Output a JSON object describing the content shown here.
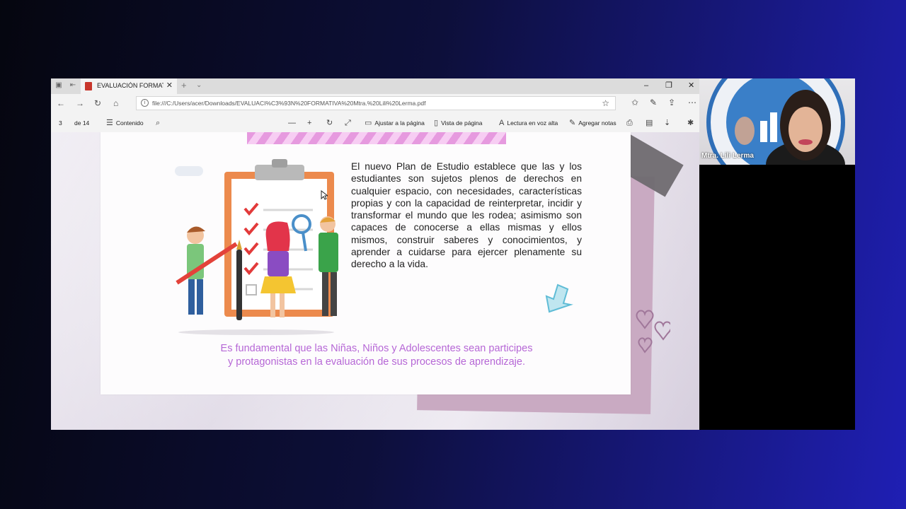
{
  "browser": {
    "tab_title": "EVALUACIÓN FORMATIV",
    "url": "file:///C:/Users/acer/Downloads/EVALUACI%C3%93N%20FORMATIVA%20Mtra.%20Lili%20Lerma.pdf",
    "window_controls": [
      "–",
      "❐",
      "✕"
    ]
  },
  "pdf_toolbar": {
    "page_current": "3",
    "page_total": "de 14",
    "contents_label": "Contenido",
    "fit_page_label": "Ajustar a la página",
    "page_view_label": "Vista de página",
    "read_aloud_label": "Lectura en voz alta",
    "add_notes_label": "Agregar notas"
  },
  "slide": {
    "body": "El nuevo Plan de Estudio establece que las y los estudiantes son sujetos plenos de derechos en cualquier espacio, con necesidades, características propias y con la capacidad de reinterpretar, incidir y transformar el mundo que les rodea; asimismo son capaces de conocerse a ellas mismas y ellos mismos, construir saberes y conocimientos, y aprender a cuidarse para ejercer plenamente su derecho a la vida.",
    "bottom_line1": "Es fundamental que las Niñas, Niños y Adolescentes sean participes",
    "bottom_line2": "y protagonistas en la evaluación de sus procesos de aprendizaje.",
    "accent_color": "#b667d6"
  },
  "video": {
    "speaker_name": "Mtra. Lili Lerma"
  }
}
